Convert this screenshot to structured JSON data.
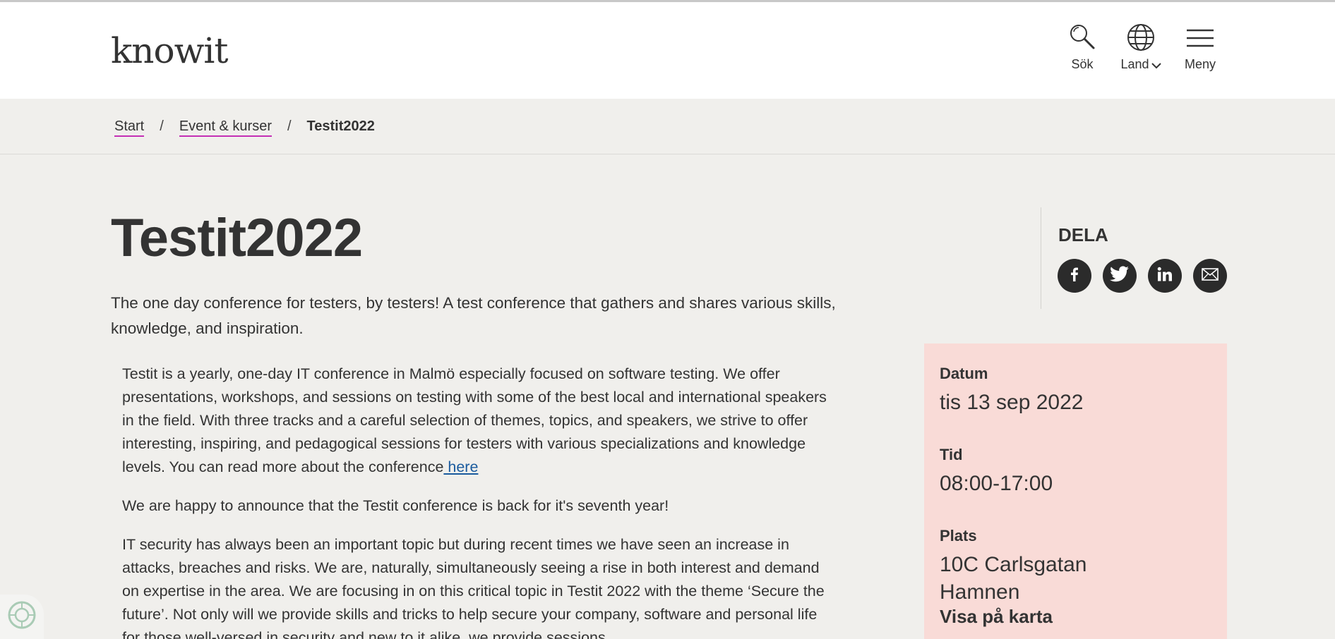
{
  "header": {
    "logo": "knowit",
    "search_label": "Sök",
    "land_label": "Land",
    "menu_label": "Meny"
  },
  "breadcrumb": {
    "items": [
      "Start",
      "Event & kurser"
    ],
    "current": "Testit2022",
    "separator": "/"
  },
  "main": {
    "title": "Testit2022",
    "lead": "The one day conference for testers, by testers! A test conference that gathers and shares various skills, knowledge, and inspiration.",
    "paragraph1": "Testit is a yearly, one-day IT conference in Malmö especially focused on software testing. We offer presentations, workshops, and sessions on testing with some of the best local and international speakers in the field. With three tracks and a careful selection of themes, topics, and speakers, we strive to offer interesting, inspiring, and pedagogical sessions for testers with various specializations and knowledge levels. You can read more about the conference",
    "paragraph1_link": " here",
    "paragraph2": "We are happy to announce that the Testit conference is back for it's seventh year!",
    "paragraph3": "IT security has always been an important topic but during recent times we have seen an increase in attacks, breaches and risks. We are, naturally, simultaneously seeing a rise in both interest and demand on expertise in the area. We are focusing in on this critical topic in Testit 2022 with the theme ‘Secure the future’. Not only will we provide skills and tricks to help secure your company, software and personal life for those well-versed in security and new to it alike, we provide sessions"
  },
  "share": {
    "title": "DELA",
    "icons": [
      "facebook-icon",
      "twitter-icon",
      "linkedin-icon",
      "email-icon"
    ]
  },
  "info": {
    "date_label": "Datum",
    "date_value": "tis 13 sep 2022",
    "time_label": "Tid",
    "time_value": "08:00-17:00",
    "place_label": "Plats",
    "place_line1": "10C Carlsgatan",
    "place_line2": "Hamnen",
    "map_link": "Visa på karta"
  },
  "colors": {
    "accent_underline": "#c42fb5",
    "info_box_bg": "#f9dbd7",
    "page_bg": "#f0efec",
    "link": "#1a5b9e"
  }
}
